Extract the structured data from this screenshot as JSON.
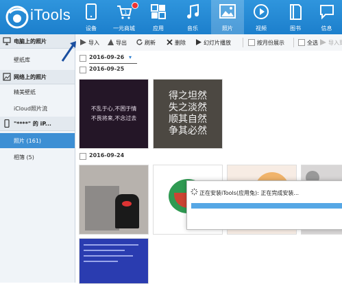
{
  "app": {
    "name": "iTools"
  },
  "nav": [
    {
      "label": "设备",
      "icon": "tablet-icon"
    },
    {
      "label": "一元商城",
      "icon": "shopping-cart-icon",
      "badge": true
    },
    {
      "label": "应用",
      "icon": "apps-grid-icon"
    },
    {
      "label": "音乐",
      "icon": "music-note-icon"
    },
    {
      "label": "照片",
      "icon": "photo-icon",
      "active": true
    },
    {
      "label": "视频",
      "icon": "play-icon"
    },
    {
      "label": "图书",
      "icon": "book-icon"
    },
    {
      "label": "信息",
      "icon": "message-icon"
    }
  ],
  "sidebar": {
    "section_pc": "电脑上的照片",
    "wallpaper_lib": "壁纸库",
    "section_web": "网络上的照片",
    "beautiful_wallpapers": "精美壁纸",
    "icloud_stream": "iCloud照片流",
    "device_name": "\"****\" 的 iP...",
    "photos": "照片 (161)",
    "albums": "相簿 (5)"
  },
  "toolbar": {
    "import": "导入",
    "export": "导出",
    "refresh": "刷新",
    "delete": "删除",
    "slideshow": "幻灯片播放",
    "by_month": "按月份展示",
    "select_all": "全选",
    "import_to_album": "导入到..."
  },
  "content": {
    "date_filter": "2016-09-26",
    "group1_date": "2016-09-25",
    "group2_date": "2016-09-24",
    "photo1_text": [
      "不乱于心,不困于情",
      "不畏将来,不念过去"
    ],
    "photo2_text": [
      "得之坦然",
      "失之淡然",
      "顺其自然",
      "争其必然"
    ]
  },
  "dialog": {
    "message": "正在安装iTools(应用兔): 正在完成安装...",
    "progress": 1.0
  },
  "colors": {
    "header": "#1f86d2",
    "active_item": "#3d8fd4",
    "arrow": "#1a4fa0"
  }
}
